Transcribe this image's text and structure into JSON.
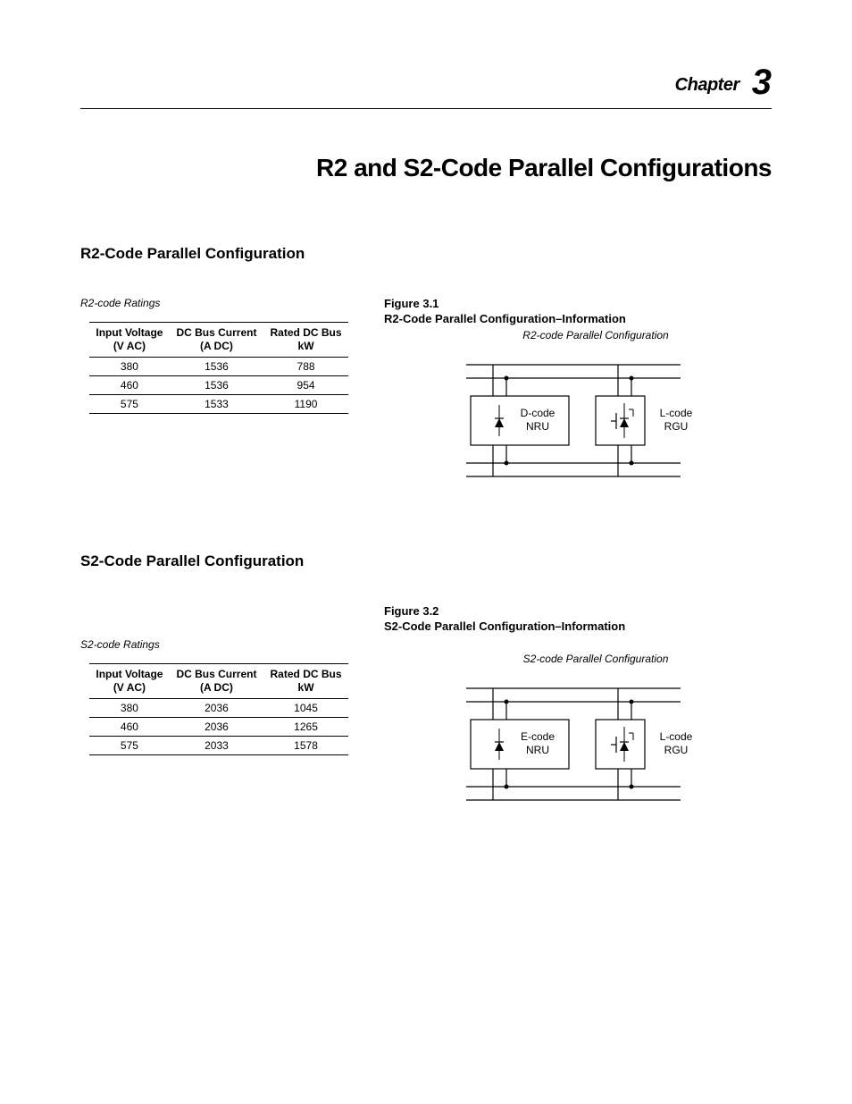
{
  "chapter": {
    "label": "Chapter",
    "number": "3"
  },
  "title": "R2 and S2-Code Parallel Configurations",
  "sections": {
    "r2": {
      "heading": "R2-Code Parallel Configuration",
      "ratings_header": "R2-code Ratings",
      "figure": {
        "number": "Figure 3.1",
        "title": "R2-Code Parallel Configuration–Information",
        "subtitle": "R2-code Parallel Configuration",
        "left_block_top": "D-code",
        "left_block_bot": "NRU",
        "right_block_top": "L-code",
        "right_block_bot": "RGU"
      },
      "table": {
        "headers": {
          "col1a": "Input Voltage",
          "col1b": "(V AC)",
          "col2a": "DC Bus Current",
          "col2b": "(A DC)",
          "col3a": "Rated DC Bus",
          "col3b": "kW"
        },
        "rows": [
          {
            "v": "380",
            "a": "1536",
            "kw": "788"
          },
          {
            "v": "460",
            "a": "1536",
            "kw": "954"
          },
          {
            "v": "575",
            "a": "1533",
            "kw": "1190"
          }
        ]
      }
    },
    "s2": {
      "heading": "S2-Code Parallel Configuration",
      "ratings_header": "S2-code Ratings",
      "figure": {
        "number": "Figure 3.2",
        "title": "S2-Code Parallel Configuration–Information",
        "subtitle": "S2-code Parallel Configuration",
        "left_block_top": "E-code",
        "left_block_bot": "NRU",
        "right_block_top": "L-code",
        "right_block_bot": "RGU"
      },
      "table": {
        "headers": {
          "col1a": "Input Voltage",
          "col1b": "(V AC)",
          "col2a": "DC Bus Current",
          "col2b": "(A DC)",
          "col3a": "Rated DC Bus",
          "col3b": "kW"
        },
        "rows": [
          {
            "v": "380",
            "a": "2036",
            "kw": "1045"
          },
          {
            "v": "460",
            "a": "2036",
            "kw": "1265"
          },
          {
            "v": "575",
            "a": "2033",
            "kw": "1578"
          }
        ]
      }
    }
  }
}
